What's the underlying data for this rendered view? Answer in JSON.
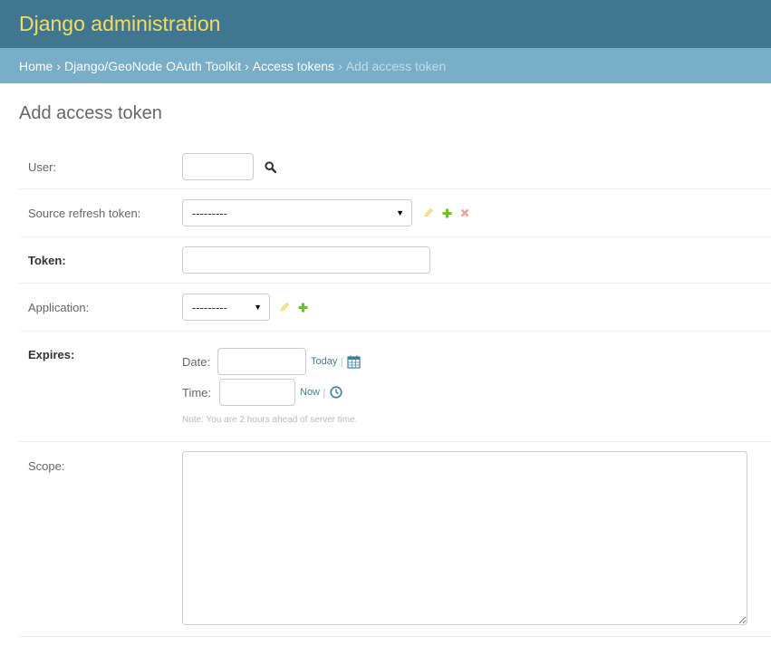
{
  "header": {
    "site_name": "Django administration"
  },
  "breadcrumbs": {
    "items": [
      "Home",
      "Django/GeoNode OAuth Toolkit",
      "Access tokens"
    ],
    "separator": "›",
    "current": "Add access token"
  },
  "page": {
    "title": "Add access token"
  },
  "form": {
    "user": {
      "label": "User:",
      "value": ""
    },
    "source_refresh_token": {
      "label": "Source refresh token:",
      "selected": "---------"
    },
    "token": {
      "label": "Token:",
      "value": ""
    },
    "application": {
      "label": "Application:",
      "selected": "---------"
    },
    "expires": {
      "label": "Expires:",
      "date_label": "Date:",
      "date_value": "",
      "today_link": "Today",
      "time_label": "Time:",
      "time_value": "",
      "now_link": "Now",
      "pipe": "|",
      "note": "Note: You are 2 hours ahead of server time."
    },
    "scope": {
      "label": "Scope:",
      "value": ""
    }
  },
  "colors": {
    "header_bg": "#417690",
    "site_name": "#f5dd5d",
    "breadcrumbs_bg": "#79aec8",
    "link": "#447e9b",
    "change_icon": "#efb80b",
    "add_icon": "#70bf2b",
    "delete_icon": "#dd4646"
  },
  "icons": {
    "lookup": "search-icon",
    "change": "pencil-icon",
    "add": "plus-icon",
    "delete": "x-icon",
    "calendar": "calendar-icon",
    "clock": "clock-icon"
  }
}
